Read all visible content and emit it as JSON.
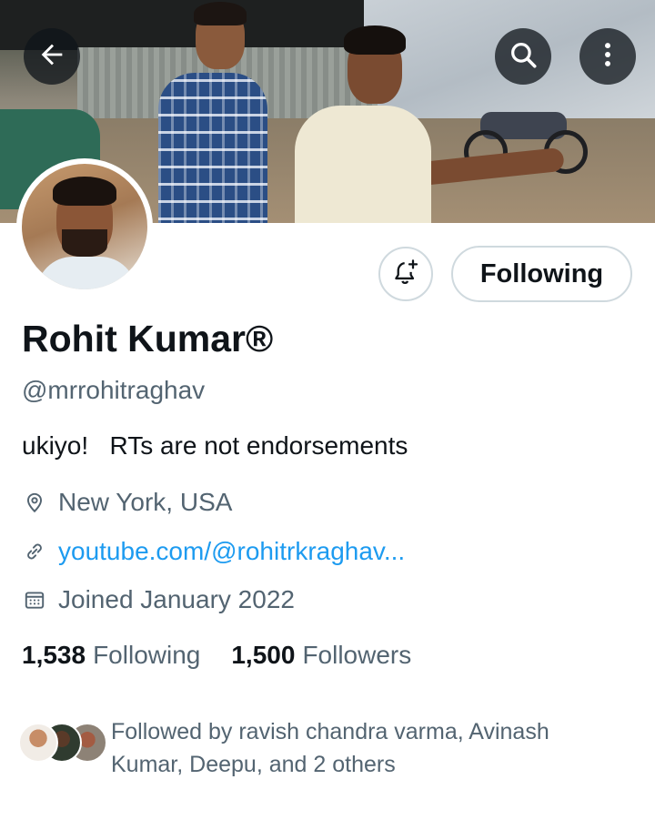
{
  "header": {
    "back_icon": "arrow-left-icon",
    "search_icon": "search-icon",
    "more_icon": "more-vertical-icon"
  },
  "profile": {
    "name": "Rohit Kumar®",
    "handle": "@mrrohitraghav",
    "bio": "ukiyo!   RTs are not endorsements",
    "location": "New York, USA",
    "website": "youtube.com/@rohitrkraghav...",
    "joined": "Joined January 2022"
  },
  "actions": {
    "notify_icon": "bell-plus-icon",
    "follow_label": "Following"
  },
  "stats": {
    "following_count": "1,538",
    "following_label": "Following",
    "followers_count": "1,500",
    "followers_label": "Followers"
  },
  "followed_by": {
    "text": "Followed by ravish chandra varma, Avinash Kumar, Deepu, and 2 others"
  },
  "colors": {
    "text_primary": "#0f1419",
    "text_secondary": "#536471",
    "link": "#1d9bf0",
    "border": "#cfd9de"
  }
}
